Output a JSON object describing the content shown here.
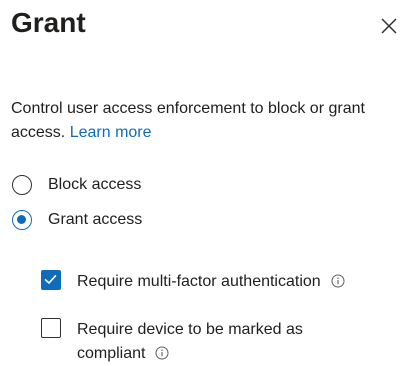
{
  "panel": {
    "title": "Grant",
    "close_icon": "close-icon",
    "description_text": "Control user access enforcement to block or grant access.",
    "learn_more_label": "Learn more"
  },
  "access_options": [
    {
      "label": "Block access",
      "selected": false
    },
    {
      "label": "Grant access",
      "selected": true
    }
  ],
  "grant_controls": [
    {
      "label": "Require multi-factor authentication",
      "checked": true,
      "icon": "info-icon"
    },
    {
      "label_line1": "Require device to be marked as",
      "label_line2": "compliant",
      "checked": false,
      "icon": "info-icon"
    }
  ],
  "colors": {
    "accent": "#0f6cbd",
    "text": "#201f1e"
  }
}
